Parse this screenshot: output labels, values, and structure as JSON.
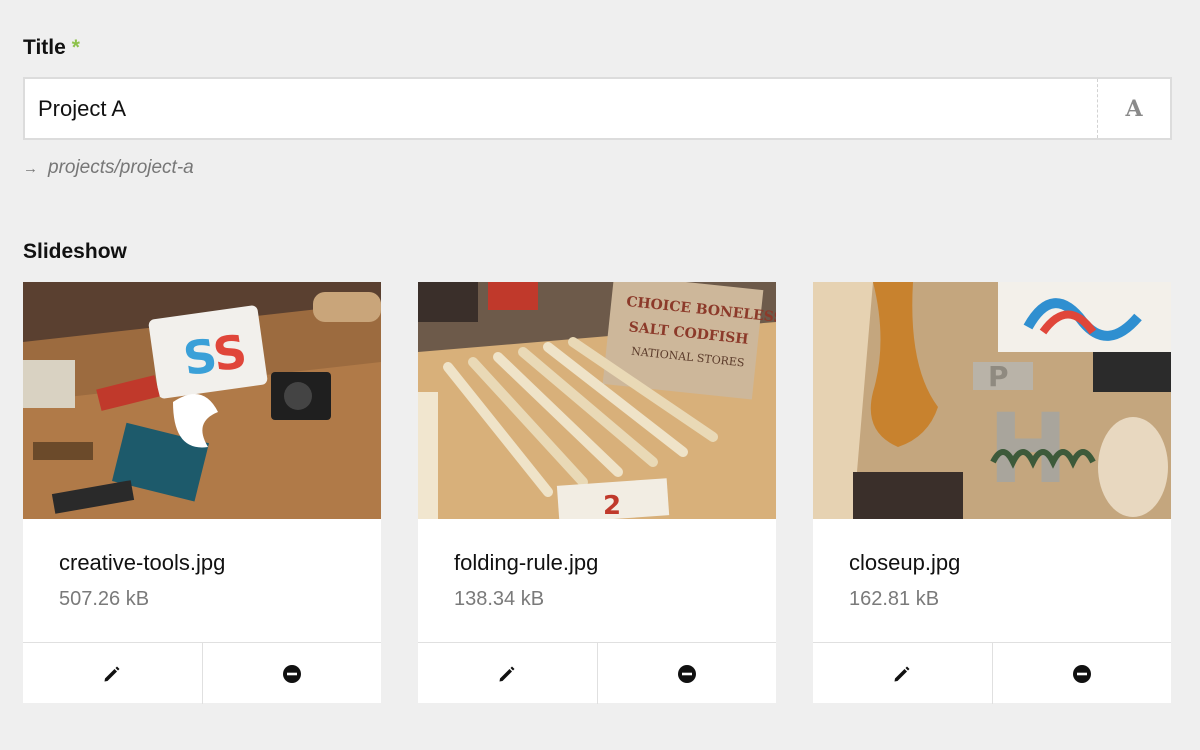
{
  "form": {
    "title_field": {
      "label": "Title",
      "required_marker": "*",
      "value": "Project A",
      "font_toggle_label": "A"
    },
    "slug": {
      "arrow": "→",
      "path": "projects/project-a"
    },
    "slideshow_field": {
      "label": "Slideshow"
    }
  },
  "slideshow": {
    "items": [
      {
        "file_name": "creative-tools.jpg",
        "file_size": "507.26 kB",
        "edit_icon": "pencil-icon",
        "remove_icon": "minus-circle-icon"
      },
      {
        "file_name": "folding-rule.jpg",
        "file_size": "138.34 kB",
        "edit_icon": "pencil-icon",
        "remove_icon": "minus-circle-icon"
      },
      {
        "file_name": "closeup.jpg",
        "file_size": "162.81 kB",
        "edit_icon": "pencil-icon",
        "remove_icon": "minus-circle-icon"
      }
    ]
  },
  "colors": {
    "page_background": "#efefef",
    "required_star": "#8dc14a",
    "meta_text": "#7a7a7a"
  }
}
